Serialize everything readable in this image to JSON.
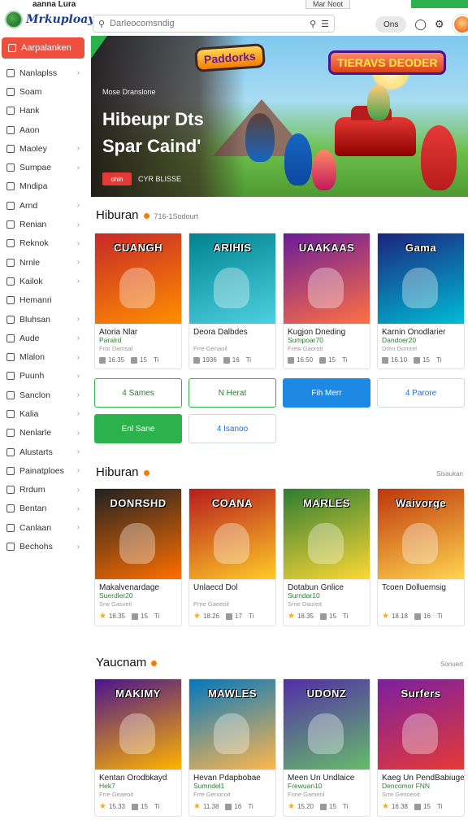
{
  "status_bar": {
    "time": "aanna Lura",
    "pill": "Mar Noot"
  },
  "app": {
    "logo_text": "Mrkuploay"
  },
  "search": {
    "placeholder": "Darleocomsndig"
  },
  "header": {
    "pill_label": "Ons"
  },
  "sidebar": {
    "active": "Aarpalanken",
    "items": [
      {
        "label": "Nanlaplss",
        "chevron": true
      },
      {
        "label": "Soam",
        "chevron": false
      },
      {
        "label": "Hank",
        "chevron": false
      },
      {
        "label": "Aaon",
        "chevron": false
      },
      {
        "label": "Maoley",
        "chevron": true
      },
      {
        "label": "Sumpae",
        "chevron": true
      },
      {
        "label": "Mndipa",
        "chevron": false
      },
      {
        "label": "Arnd",
        "chevron": true
      },
      {
        "label": "Renian",
        "chevron": true
      },
      {
        "label": "Reknok",
        "chevron": true
      },
      {
        "label": "Nrnle",
        "chevron": true
      },
      {
        "label": "Kailok",
        "chevron": true
      },
      {
        "label": "Hemanri",
        "chevron": false
      },
      {
        "label": "Bluhsan",
        "chevron": true
      },
      {
        "label": "Aude",
        "chevron": true
      },
      {
        "label": "Mlalon",
        "chevron": true
      },
      {
        "label": "Puunh",
        "chevron": true
      },
      {
        "label": "Sanclon",
        "chevron": true
      },
      {
        "label": "Kalia",
        "chevron": true
      },
      {
        "label": "Nenlarle",
        "chevron": true
      },
      {
        "label": "Alustarts",
        "chevron": true
      },
      {
        "label": "Painatploes",
        "chevron": true
      },
      {
        "label": "Rrdum",
        "chevron": true
      },
      {
        "label": "Bentan",
        "chevron": true
      },
      {
        "label": "Canlaan",
        "chevron": true
      },
      {
        "label": "Bechohs",
        "chevron": true
      }
    ]
  },
  "hero": {
    "logo_left": "Paddorks",
    "logo_right": "TIERAVS DEODER",
    "tagline": "Mose Dranslone",
    "headline_1": "Hibeupr Dts",
    "headline_2": "Spar Caind'",
    "cta_button": "ohin",
    "cta_text": "CYR BLISSE"
  },
  "sections": [
    {
      "title": "Hiburan",
      "subtitle": "716-1Sodourt",
      "more": "",
      "cards": [
        {
          "art_title": "CUANGH",
          "name": "Atoria Nlar",
          "price": "Paralrd",
          "meta": "Fror Damsal",
          "stat1": "16.35",
          "stat2": "15",
          "stat3": "Ti",
          "colors": [
            "#c62828",
            "#ff8f00"
          ]
        },
        {
          "art_title": "ARIHIS",
          "name": "Deora Dalbdes",
          "price": "",
          "meta": "Frre Genaoil",
          "stat1": "1936",
          "stat2": "16",
          "stat3": "Ti",
          "colors": [
            "#00838f",
            "#4dd0e1"
          ]
        },
        {
          "art_title": "UAAKAAS",
          "name": "Kugjon Dneding",
          "price": "Sumpoar70",
          "meta": "Frew Gaoroit",
          "stat1": "16.50",
          "stat2": "15",
          "stat3": "Ti",
          "colors": [
            "#6a1b9a",
            "#ff7043"
          ]
        },
        {
          "art_title": "Gama",
          "name": "Karnin Onodlarier",
          "price": "Dandoer20",
          "meta": "Dren Gomrel",
          "stat1": "16.10",
          "stat2": "15",
          "stat3": "Ti",
          "colors": [
            "#1a237e",
            "#00bcd4"
          ]
        }
      ],
      "buttons": [
        {
          "label": "4 Sames",
          "style": "outline-g"
        },
        {
          "label": "N Herat",
          "style": "outline-g"
        },
        {
          "label": "Fih Merr",
          "style": "solid-b"
        },
        {
          "label": "4 Parore",
          "style": "outline-b"
        },
        {
          "label": "Enl Sane",
          "style": "solid-g"
        },
        {
          "label": "4 Isanoo",
          "style": "outline-b"
        }
      ]
    },
    {
      "title": "Hiburan",
      "subtitle": "",
      "more": "Sisaukan",
      "cards": [
        {
          "art_title": "DONRSHD",
          "name": "Makalvenardage",
          "price": "Suerdler20",
          "meta": "Srw Gasveil",
          "stat1": "18.35",
          "stat2": "15",
          "stat3": "Ti",
          "colors": [
            "#212121",
            "#ff6f00"
          ]
        },
        {
          "art_title": "COANA",
          "name": "Unlaecd Dol",
          "price": "",
          "meta": "Prne Gaeeoil",
          "stat1": "18.26",
          "stat2": "17",
          "stat3": "Ti",
          "colors": [
            "#b71c1c",
            "#ffca28"
          ]
        },
        {
          "art_title": "MARLES",
          "name": "Dotabun Gnlice",
          "price": "Surndar10",
          "meta": "Srne Daureit",
          "stat1": "18.35",
          "stat2": "15",
          "stat3": "Ti",
          "colors": [
            "#2e7d32",
            "#fdd835"
          ]
        },
        {
          "art_title": "Waivorge",
          "name": "Tcoen Dolluemsig",
          "price": "",
          "meta": "",
          "stat1": "18.18",
          "stat2": "16",
          "stat3": "Ti",
          "colors": [
            "#bf360c",
            "#ffd54f"
          ]
        }
      ]
    },
    {
      "title": "Yaucnam",
      "subtitle": "",
      "more": "Sonuert",
      "cards": [
        {
          "art_title": "MAKIMY",
          "name": "Kentan Orodbkayd",
          "price": "Hek7",
          "meta": "Frre Geaeoit",
          "stat1": "15.33",
          "stat2": "15",
          "stat3": "Ti",
          "colors": [
            "#4a148c",
            "#ffb300"
          ]
        },
        {
          "art_title": "MAWLES",
          "name": "Hevan Pdapbobae",
          "price": "Sumndel1",
          "meta": "Frre Genocoit",
          "stat1": "11.38",
          "stat2": "16",
          "stat3": "Ti",
          "colors": [
            "#0277bd",
            "#ffb74d"
          ]
        },
        {
          "art_title": "UDONZ",
          "name": "Meen Un Undlaice",
          "price": "Frewuan10",
          "meta": "Fnne Gamenl",
          "stat1": "15.20",
          "stat2": "15",
          "stat3": "Ti",
          "colors": [
            "#512da8",
            "#66bb6a"
          ]
        },
        {
          "art_title": "Surfers",
          "name": "Kaeg Un PendBabiuge",
          "price": "Dencomor FNN",
          "meta": "Srre Genoeoit",
          "stat1": "16.38",
          "stat2": "15",
          "stat3": "Ti",
          "colors": [
            "#7b1fa2",
            "#e53935"
          ]
        }
      ]
    }
  ]
}
